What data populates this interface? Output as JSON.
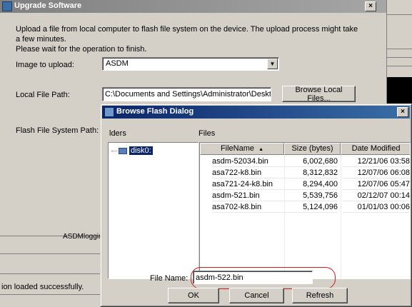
{
  "background": {
    "log_fragment": "ASDMlogging",
    "status_text": "ion loaded successfully."
  },
  "upload_window": {
    "title": "Upgrade Software",
    "description_line1": "Upload a file from local computer to flash file system on the device. The upload process might take a few minutes.",
    "description_line2": "Please wait for the operation to finish.",
    "image_label": "Image to upload:",
    "image_value": "ASDM",
    "local_path_label": "Local File Path:",
    "local_path_value": "C:\\Documents and Settings\\Administrator\\Desktop\\Prabu\\PIX",
    "browse_local_label": "Browse Local Files...",
    "flash_path_label": "Flash File System Path:",
    "close_glyph": "×"
  },
  "dialog": {
    "title": "Browse Flash Dialog",
    "folders_label": "lders",
    "files_label": "Files",
    "tree_root": "disk0:",
    "columns": [
      "FileName",
      "Size (bytes)",
      "Date Modified"
    ],
    "sort_indicator": "▲",
    "files": [
      {
        "name": "asdm-52034.bin",
        "size": "6,002,680",
        "date": "12/21/06 03:58"
      },
      {
        "name": "asa722-k8.bin",
        "size": "8,312,832",
        "date": "12/07/06 06:08"
      },
      {
        "name": "asa721-24-k8.bin",
        "size": "8,294,400",
        "date": "12/07/06 05:47"
      },
      {
        "name": "asdm-521.bin",
        "size": "5,539,756",
        "date": "02/12/07 00:14"
      },
      {
        "name": "asa702-k8.bin",
        "size": "5,124,096",
        "date": "01/01/03 00:06"
      }
    ],
    "file_name_label": "File Name:",
    "file_name_value": "asdm-522.bin",
    "ok_label": "OK",
    "cancel_label": "Cancel",
    "refresh_label": "Refresh",
    "close_glyph": "×"
  },
  "colors": {
    "dialog_titlebar": "#0a246a",
    "selection": "#0a246a",
    "highlight_oval": "#d21b1b"
  }
}
